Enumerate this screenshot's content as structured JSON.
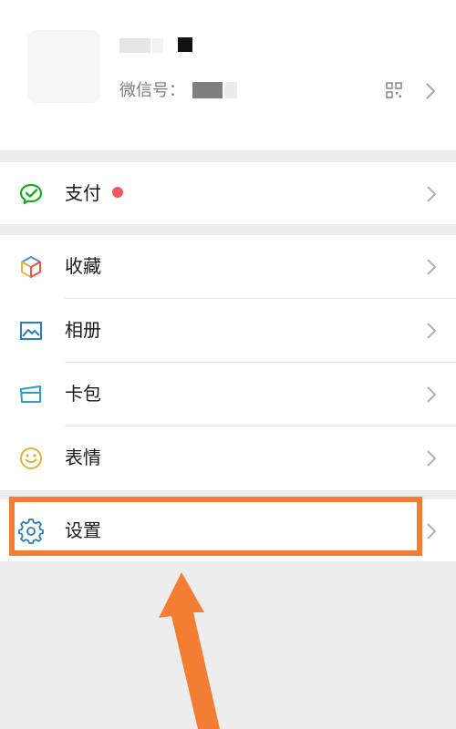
{
  "profile": {
    "wechat_id_label": "微信号："
  },
  "menu": {
    "pay": {
      "label": "支付",
      "icon": "wechat-pay-icon"
    },
    "favorites": {
      "label": "收藏",
      "icon": "cube-icon"
    },
    "album": {
      "label": "相册",
      "icon": "image-icon"
    },
    "cards": {
      "label": "卡包",
      "icon": "card-icon"
    },
    "stickers": {
      "label": "表情",
      "icon": "smiley-icon"
    },
    "settings": {
      "label": "设置",
      "icon": "gear-icon"
    }
  },
  "colors": {
    "background": "#ededed",
    "panel": "#ffffff",
    "text": "#1a1a1a",
    "pay_green": "#1aad19",
    "badge_red": "#f25a5a",
    "annotation_orange": "#f47d34",
    "settings_blue": "#2b7dbd"
  }
}
